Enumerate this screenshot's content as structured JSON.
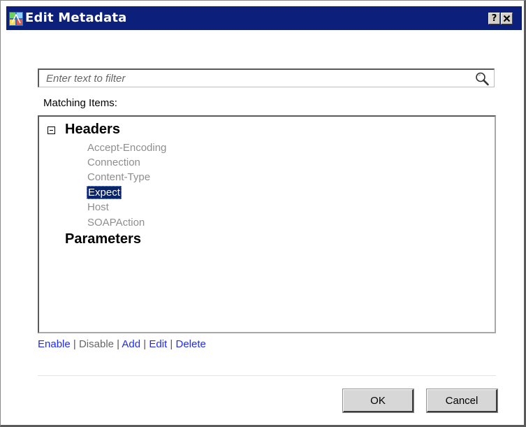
{
  "window": {
    "title": "Edit Metadata",
    "help_label": "?",
    "close_label": "✕",
    "icon": "app-metadata-icon"
  },
  "filter": {
    "placeholder": "Enter text to filter",
    "value": "",
    "icon": "search-icon"
  },
  "matching_label": "Matching Items:",
  "tree": {
    "groups": [
      {
        "label": "Headers",
        "expanded": true,
        "expander": "⊟",
        "items": [
          {
            "label": "Accept-Encoding",
            "selected": false
          },
          {
            "label": "Connection",
            "selected": false
          },
          {
            "label": "Content-Type",
            "selected": false
          },
          {
            "label": "Expect",
            "selected": true
          },
          {
            "label": "Host",
            "selected": false
          },
          {
            "label": "SOAPAction",
            "selected": false
          }
        ]
      },
      {
        "label": "Parameters",
        "expanded": false,
        "items": []
      }
    ]
  },
  "actions": {
    "enable": "Enable",
    "disable": "Disable",
    "add": "Add",
    "edit": "Edit",
    "delete": "Delete",
    "separator": "|"
  },
  "buttons": {
    "ok": "OK",
    "cancel": "Cancel"
  },
  "colors": {
    "titlebar": "#0c1f7a",
    "selection": "#0a246a",
    "link": "#1f2bff",
    "disabled_link": "#666666",
    "item_text": "#8e8e8e"
  }
}
